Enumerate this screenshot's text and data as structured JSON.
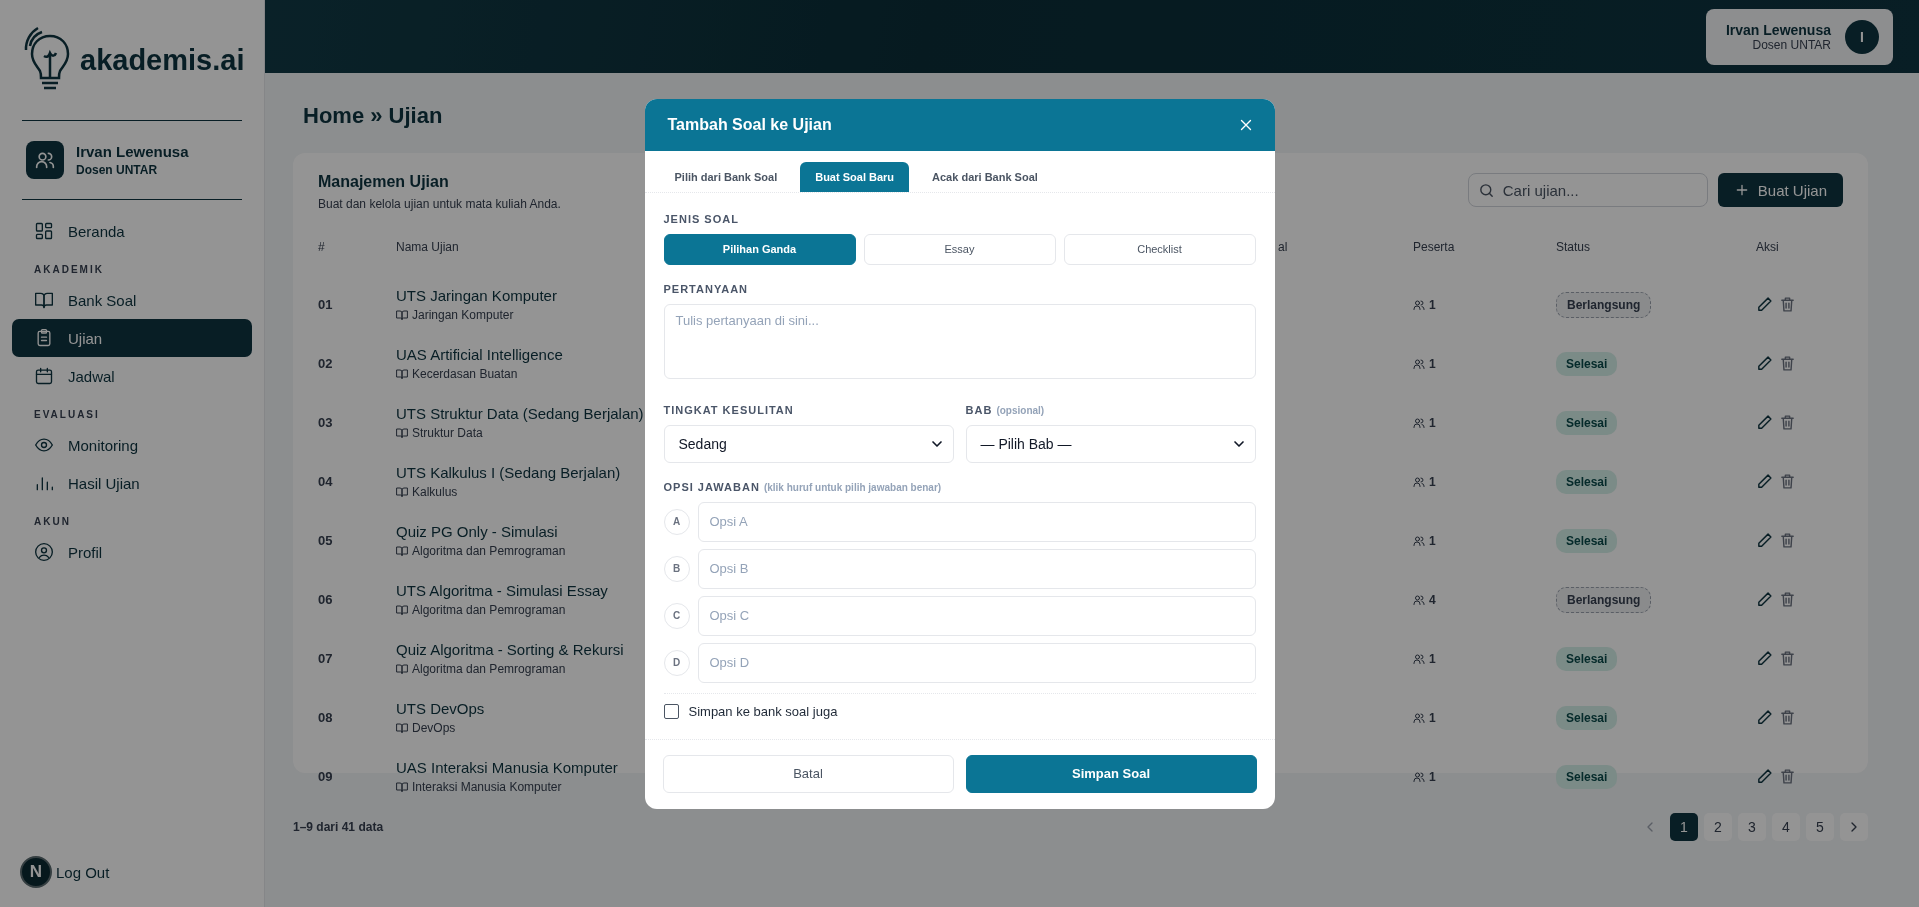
{
  "sidebar": {
    "logo": "akademis.ai",
    "user": {
      "name": "Irvan Lewenusa",
      "role": "Dosen UNTAR"
    },
    "sections": [
      {
        "items": [
          {
            "label": "Beranda",
            "selected": false
          }
        ]
      },
      {
        "heading": "AKADEMIK",
        "items": [
          {
            "label": "Bank Soal",
            "selected": false
          },
          {
            "label": "Ujian",
            "selected": true
          },
          {
            "label": "Jadwal",
            "selected": false
          }
        ]
      },
      {
        "heading": "EVALUASI",
        "items": [
          {
            "label": "Monitoring",
            "selected": false
          },
          {
            "label": "Hasil Ujian",
            "selected": false
          }
        ]
      },
      {
        "heading": "AKUN",
        "items": [
          {
            "label": "Profil",
            "selected": false
          }
        ]
      }
    ],
    "logout": "Log Out",
    "dev_badge": "N"
  },
  "topbar": {
    "user": {
      "name": "Irvan Lewenusa",
      "role": "Dosen UNTAR",
      "initial": "I"
    }
  },
  "breadcrumb": "Home » Ujian",
  "exam_card": {
    "title": "Manajemen Ujian",
    "subtitle": "Buat dan kelola ujian untuk mata kuliah Anda.",
    "search": {
      "placeholder": "Cari ujian..."
    },
    "create_button": "Buat Ujian",
    "columns": [
      "#",
      "Nama Ujian",
      "al",
      "Peserta",
      "Status",
      "Aksi"
    ],
    "rows": [
      {
        "number": "01",
        "name": "UTS Jaringan Komputer",
        "course": "Jaringan Komputer",
        "participants": "1",
        "status": {
          "label": "Berlangsung",
          "kind": "ongoing"
        }
      },
      {
        "number": "02",
        "name": "UAS Artificial Intelligence",
        "course": "Kecerdasan Buatan",
        "participants": "1",
        "status": {
          "label": "Selesai",
          "kind": "done"
        }
      },
      {
        "number": "03",
        "name": "UTS Struktur Data (Sedang Berjalan)",
        "course": "Struktur Data",
        "participants": "1",
        "status": {
          "label": "Selesai",
          "kind": "done"
        }
      },
      {
        "number": "04",
        "name": "UTS Kalkulus I (Sedang Berjalan)",
        "course": "Kalkulus",
        "participants": "1",
        "status": {
          "label": "Selesai",
          "kind": "done"
        }
      },
      {
        "number": "05",
        "name": "Quiz PG Only - Simulasi",
        "course": "Algoritma dan Pemrograman",
        "participants": "1",
        "status": {
          "label": "Selesai",
          "kind": "done"
        }
      },
      {
        "number": "06",
        "name": "UTS Algoritma - Simulasi Essay",
        "course": "Algoritma dan Pemrograman",
        "participants": "4",
        "status": {
          "label": "Berlangsung",
          "kind": "ongoing"
        }
      },
      {
        "number": "07",
        "name": "Quiz Algoritma - Sorting & Rekursi",
        "course": "Algoritma dan Pemrograman",
        "participants": "1",
        "status": {
          "label": "Selesai",
          "kind": "done"
        }
      },
      {
        "number": "08",
        "name": "UTS DevOps",
        "course": "DevOps",
        "participants": "1",
        "status": {
          "label": "Selesai",
          "kind": "done"
        }
      },
      {
        "number": "09",
        "name": "UAS Interaksi Manusia Komputer",
        "course": "Interaksi Manusia Komputer",
        "participants": "1",
        "status": {
          "label": "Selesai",
          "kind": "done"
        }
      }
    ]
  },
  "pagination": {
    "info": "1–9 dari 41 data",
    "pages": [
      {
        "label": "1",
        "selected": true
      },
      {
        "label": "2",
        "selected": false
      },
      {
        "label": "3",
        "selected": false
      },
      {
        "label": "4",
        "selected": false
      },
      {
        "label": "5",
        "selected": false
      }
    ]
  },
  "modal": {
    "title": "Tambah Soal ke Ujian",
    "tabs": [
      {
        "label": "Pilih dari Bank Soal",
        "selected": false
      },
      {
        "label": "Buat Soal Baru",
        "selected": true
      },
      {
        "label": "Acak dari Bank Soal",
        "selected": false
      }
    ],
    "type_label": "JENIS SOAL",
    "types": [
      {
        "label": "Pilihan Ganda",
        "selected": true
      },
      {
        "label": "Essay",
        "selected": false
      },
      {
        "label": "Checklist",
        "selected": false
      }
    ],
    "question_label": "PERTANYAAN",
    "question_placeholder": "Tulis pertanyaan di sini...",
    "difficulty_label": "TINGKAT KESULITAN",
    "difficulty_value": "Sedang",
    "chapter_label": "BAB",
    "chapter_note": "(opsional)",
    "chapter_value": "— Pilih Bab —",
    "options_label": "OPSI JAWABAN",
    "options_note": "(klik huruf untuk pilih jawaban benar)",
    "options": [
      {
        "letter": "A",
        "placeholder": "Opsi A"
      },
      {
        "letter": "B",
        "placeholder": "Opsi B"
      },
      {
        "letter": "C",
        "placeholder": "Opsi C"
      },
      {
        "letter": "D",
        "placeholder": "Opsi D"
      }
    ],
    "save_to_bank": {
      "label": "Simpan ke bank soal juga",
      "checked": false
    },
    "cancel_button": "Batal",
    "save_button": "Simpan Soal"
  }
}
